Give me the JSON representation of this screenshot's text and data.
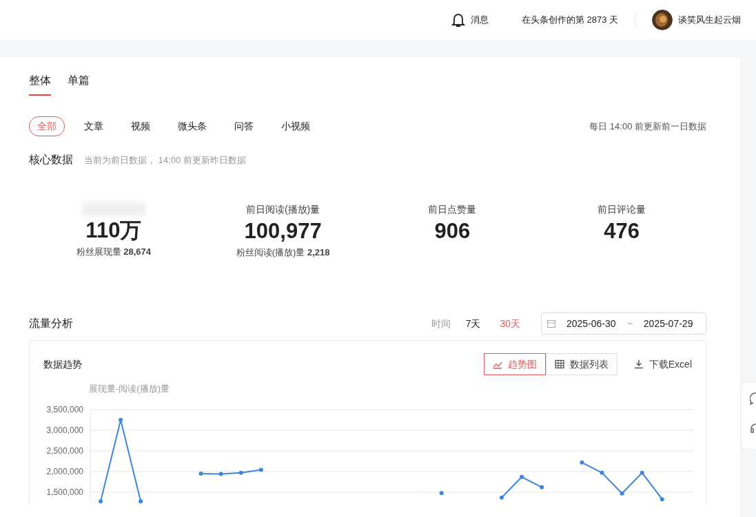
{
  "header": {
    "messages_label": "消息",
    "days_text": "在头条创作的第 2873 天",
    "username": "谈笑风生起云烟"
  },
  "view_tabs": [
    {
      "label": "整体",
      "selected": true
    },
    {
      "label": "单篇",
      "selected": false
    }
  ],
  "content_filters": [
    {
      "label": "全部",
      "selected": true
    },
    {
      "label": "文章",
      "selected": false
    },
    {
      "label": "视频",
      "selected": false
    },
    {
      "label": "微头条",
      "selected": false
    },
    {
      "label": "问答",
      "selected": false
    },
    {
      "label": "小视频",
      "selected": false
    }
  ],
  "update_note": "每日 14:00 前更新前一日数据",
  "core": {
    "title": "核心数据",
    "note": "当前为前日数据， 14:00 前更新昨日数据",
    "stats": [
      {
        "blurred": true,
        "value": "110万",
        "sub": "粉丝展现量 **28,674**"
      },
      {
        "label": "前日阅读(播放)量",
        "value": "100,977",
        "sub": "粉丝阅读(播放)量 **2,218**"
      },
      {
        "label": "前日点赞量",
        "value": "906"
      },
      {
        "label": "前日评论量",
        "value": "476"
      }
    ]
  },
  "traffic": {
    "title": "流量分析",
    "time_label": "时间",
    "ranges": [
      {
        "label": "7天",
        "selected": false
      },
      {
        "label": "30天",
        "selected": true
      }
    ],
    "date_start": "2025-06-30",
    "date_separator": "~",
    "date_end": "2025-07-29",
    "card": {
      "title": "数据趋势",
      "view_buttons": [
        {
          "kind": "trend",
          "label": "趋势图",
          "selected": true
        },
        {
          "kind": "table",
          "label": "数据列表",
          "selected": false
        }
      ],
      "download_label": "下载Excel",
      "chart_data": {
        "type": "line",
        "grid": true,
        "ylim": [
          1250000,
          3500000
        ],
        "yticks": [
          {
            "value": 1500000,
            "label": "1,500,000"
          },
          {
            "value": 2000000,
            "label": "2,000,000"
          },
          {
            "value": 2500000,
            "label": "2,500,000"
          },
          {
            "value": 3000000,
            "label": "3,000,000"
          },
          {
            "value": 3500000,
            "label": "3,500,000"
          }
        ],
        "series": [
          {
            "name": "展现量-阅读(播放)量",
            "color": "#3d86e0",
            "marker": true,
            "values": [
              1280000,
              3250000,
              1280000,
              null,
              null,
              1950000,
              1940000,
              1970000,
              2040000,
              null,
              null,
              null,
              null,
              null,
              null,
              null,
              null,
              1480000,
              null,
              null,
              1370000,
              1870000,
              1620000,
              null,
              2220000,
              1970000,
              1470000,
              1970000,
              1330000,
              null
            ]
          }
        ]
      }
    }
  }
}
